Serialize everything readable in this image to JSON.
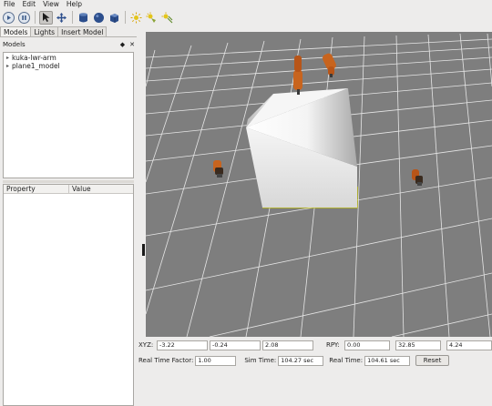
{
  "menu": [
    "File",
    "Edit",
    "View",
    "Help"
  ],
  "toolbar": {
    "icons": [
      "play-icon",
      "pause-icon",
      "select-arrow-icon",
      "translate-icon",
      "cylinder-icon",
      "sphere-icon",
      "box-icon",
      "sun-icon",
      "spotlight-icon",
      "directional-light-icon"
    ]
  },
  "tabs": [
    "Models",
    "Lights",
    "Insert Model"
  ],
  "models_panel": {
    "title": "Models",
    "items": [
      "kuka-lwr-arm",
      "plane1_model"
    ]
  },
  "property_table": {
    "columns": [
      "Property",
      "Value"
    ]
  },
  "pose": {
    "xyz_label": "XYZ:",
    "x": "-3.22",
    "y": "-0.24",
    "z": "2.08",
    "rpy_label": "RPY:",
    "roll": "0.00",
    "pitch": "32.85",
    "yaw": "4.24"
  },
  "status": {
    "rtf_label": "Real Time Factor:",
    "rtf": "1.00",
    "sim_label": "Sim Time:",
    "sim": "104.27 sec",
    "real_label": "Real Time:",
    "real": "104.61 sec",
    "reset_label": "Reset"
  },
  "colors": {
    "viewport_bg": "#7e7e7e",
    "grid": "#ffffff",
    "selection": "#cccc00",
    "robot": "#c8641e",
    "toolbar_blue": "#2c4e8c"
  }
}
